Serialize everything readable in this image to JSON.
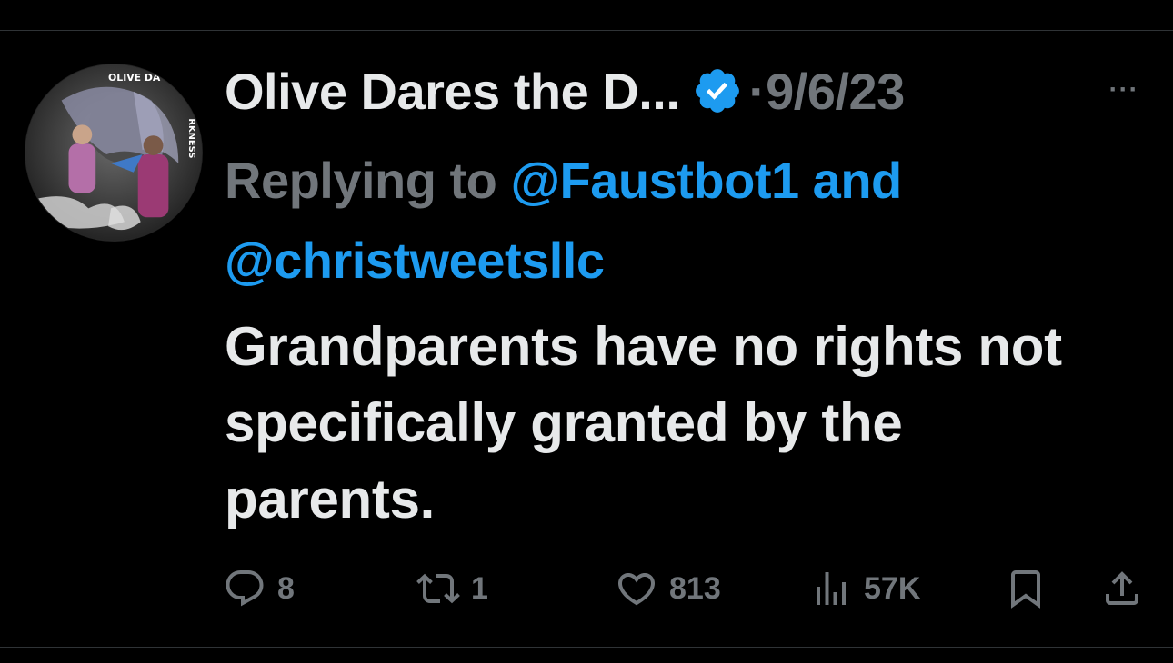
{
  "tweet": {
    "author": {
      "display_name": "Olive Dares the D...",
      "verified_icon": "verified-badge-icon",
      "avatar_text_top": "OLIVE DA...",
      "avatar_text_side": "...RKNESS"
    },
    "separator": "·",
    "date": "9/6/23",
    "more_label": "···",
    "replying_prefix": "Replying to ",
    "mentions": [
      "@Faustbot1",
      "@christweetsllc"
    ],
    "mention_conjunction": " and",
    "text_lines": [
      "Grandparents have no rights not",
      "specifically granted by the",
      "parents."
    ]
  },
  "actions": {
    "reply": {
      "icon": "reply-icon",
      "count": "8"
    },
    "retweet": {
      "icon": "retweet-icon",
      "count": "1"
    },
    "like": {
      "icon": "heart-icon",
      "count": "813"
    },
    "views": {
      "icon": "views-chart-icon",
      "count": "57K"
    },
    "bookmark": {
      "icon": "bookmark-icon"
    },
    "share": {
      "icon": "share-icon"
    }
  },
  "colors": {
    "background": "#000000",
    "text_primary": "#e7e9ea",
    "text_secondary": "#71767b",
    "accent": "#1d9bf0",
    "divider": "#2f3336"
  }
}
